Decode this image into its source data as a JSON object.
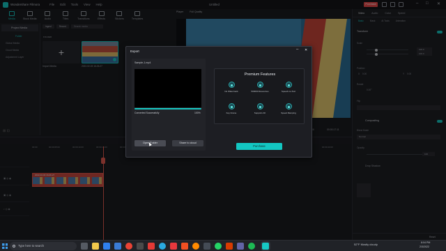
{
  "app": {
    "name": "Wondershare Filmora",
    "menu": [
      "File",
      "Edit",
      "Tools",
      "View",
      "Help"
    ],
    "document_title": "Untitled",
    "promo_label": "Purchase"
  },
  "toolbar": {
    "items": [
      {
        "label": "Media",
        "active": true
      },
      {
        "label": "Stock Media",
        "active": false
      },
      {
        "label": "Audio",
        "active": false
      },
      {
        "label": "Titles",
        "active": false
      },
      {
        "label": "Transitions",
        "active": false
      },
      {
        "label": "Effects",
        "active": false
      },
      {
        "label": "Stickers",
        "active": false
      },
      {
        "label": "Templates",
        "active": false
      }
    ]
  },
  "left_panel": {
    "header": "Project Media",
    "items": [
      "Folder",
      "Global Media",
      "Cloud Media",
      "Adjustment Layer"
    ]
  },
  "media": {
    "filter": "Ingest",
    "record": "Record",
    "search_placeholder": "Search media",
    "folder_label": "FOLDER",
    "import_label": "Import Media",
    "clip_label": "2022-02-03 16-06-27"
  },
  "player": {
    "label": "Player",
    "quality": "Full Quality",
    "time_current": "00:00:15:06",
    "time_total": "00:00:17:11"
  },
  "right_panel": {
    "tabs": [
      "Video",
      "Audio",
      "Color",
      "Speed"
    ],
    "subtabs": [
      "Basic",
      "Mask",
      "AI Tools",
      "Animation"
    ],
    "sections": {
      "transform": "Transform",
      "scale": "Scale",
      "scale_value": "100.0",
      "position": "Position",
      "pos_x_label": "X",
      "pos_x_value": "0.00",
      "pos_y_label": "Y",
      "pos_y_value": "0.00",
      "rotate": "Rotate",
      "rotate_value": "0.00°",
      "flip": "Flip",
      "compositing": "Compositing",
      "blend_mode": "Blend Mode",
      "blend_value": "Normal",
      "opacity": "Opacity",
      "opacity_value": "100",
      "drop_shadow": "Drop Shadow"
    },
    "footer_reset": "Reset"
  },
  "timeline": {
    "ruler": [
      "00:00",
      "00:00:05:00",
      "00:00:10:00",
      "00:00:15:00",
      "00:00:20:00",
      "00:00:25:00",
      "00:00:30:00",
      "00:00:35:00",
      "00:00:40:00"
    ],
    "clip_name": "2022-02-03 16-06-27"
  },
  "export_dialog": {
    "title": "Export",
    "filename": "Sample-1.mp4",
    "status": "Converted Successfully",
    "progress_label": "100%",
    "progress": 1.0,
    "open_folder": "Open Folder",
    "share_to_cloud": "Share to cloud",
    "premium_title": "Premium Features",
    "features": [
      "No Watermark",
      "500000 Resources",
      "Speech-to-Text",
      "Key Frame",
      "Supports 4K",
      "Speed Ramping"
    ],
    "purchase": "Purchase"
  },
  "taskbar": {
    "search_placeholder": "Type here to search",
    "weather": "52°F Mostly cloudy",
    "time": "8:04 PM",
    "date": "2/3/2022"
  },
  "colors": {
    "accent": "#17c9c4",
    "playhead": "#e25a4f",
    "background": "#1b1c20"
  }
}
